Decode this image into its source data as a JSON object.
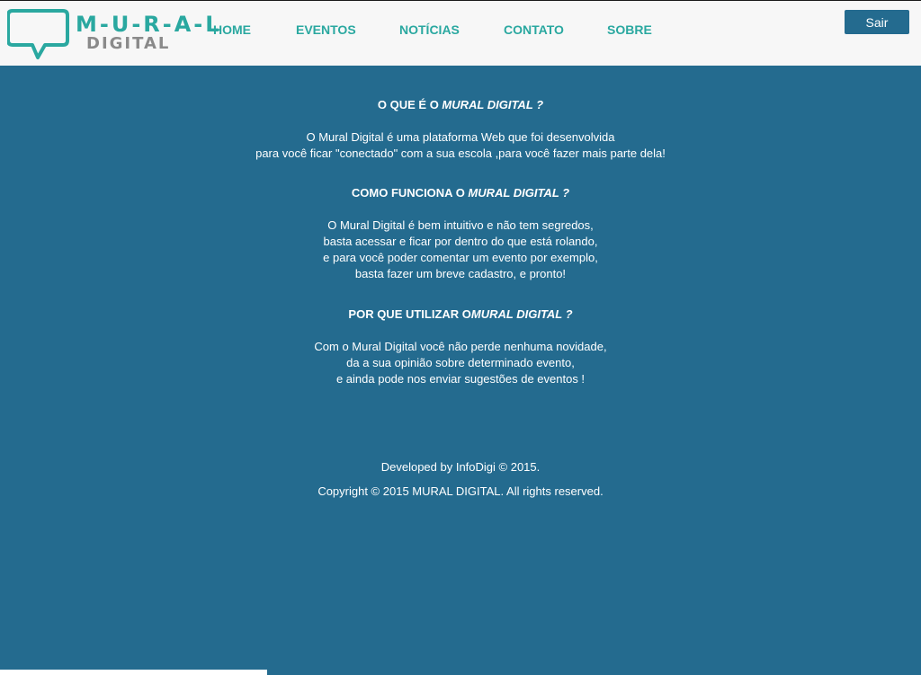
{
  "logo": {
    "word1": "M-U-R-A-L",
    "word2": "DIGITAL"
  },
  "nav": [
    {
      "label": "HOME"
    },
    {
      "label": "EVENTOS"
    },
    {
      "label": "NOTÍCIAS"
    },
    {
      "label": "CONTATO"
    },
    {
      "label": "SOBRE"
    }
  ],
  "header": {
    "logout_label": "Sair"
  },
  "sections": [
    {
      "title_prefix": "O QUE É O ",
      "title_emphasis": "MURAL DIGITAL ?",
      "lines": [
        "O Mural Digital é uma plataforma Web que foi desenvolvida",
        "para você ficar \"conectado\" com a sua escola ,para você fazer mais parte dela!"
      ]
    },
    {
      "title_prefix": "COMO FUNCIONA O ",
      "title_emphasis": "MURAL DIGITAL ?",
      "lines": [
        "O Mural Digital é bem intuitivo e não tem segredos,",
        "basta acessar e ficar por dentro do que está rolando,",
        "e para você poder comentar um evento por exemplo,",
        "basta fazer um breve cadastro, e pronto!"
      ]
    },
    {
      "title_prefix": "POR QUE UTILIZAR O",
      "title_emphasis": "MURAL DIGITAL ?",
      "lines": [
        "Com o Mural Digital você não perde nenhuma novidade,",
        "da a sua opinião sobre determinado evento,",
        "e ainda pode nos enviar sugestões de eventos !"
      ]
    }
  ],
  "footer": {
    "developed_by": "Developed by InfoDigi © 2015.",
    "copyright": "Copyright © 2015 MURAL DIGITAL. All rights reserved."
  },
  "colors": {
    "background": "#246b8f",
    "header_bg": "#f7f7f7",
    "nav_text": "#2aa8a0",
    "logo_gray": "#8a8a8a"
  }
}
